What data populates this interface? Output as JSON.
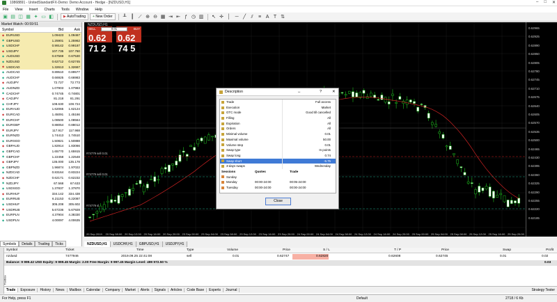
{
  "window": {
    "title": "10868891 - UnitedStandardFX-Demo: Demo Account - Hedge - [NZDUSD,H1]",
    "controls": [
      "–",
      "□",
      "✕"
    ]
  },
  "menu": [
    "File",
    "View",
    "Insert",
    "Charts",
    "Tools",
    "Window",
    "Help"
  ],
  "toolbar": {
    "autotrading": "AutoTrading",
    "new_order": "New Order"
  },
  "market_watch": {
    "title": "Market Watch: 00:59:51",
    "cols": {
      "symbol": "Symbol",
      "bid": "Bid",
      "ask": "Ask"
    },
    "rows": [
      {
        "sym": "EURUSD",
        "bid": "1.09423",
        "ask": "1.09467",
        "hl": true
      },
      {
        "sym": "GBPUSD",
        "bid": "1.25901",
        "ask": "1.25962",
        "hl": true
      },
      {
        "sym": "USDCHF",
        "bid": "0.99142",
        "ask": "0.99187",
        "hl": true
      },
      {
        "sym": "USDJPY",
        "bid": "107.735",
        "ask": "107.760",
        "hl": true
      },
      {
        "sym": "AUDUSD",
        "bid": "0.67569",
        "ask": "0.67530",
        "hl": true
      },
      {
        "sym": "NZDUSD",
        "bid": "0.62712",
        "ask": "0.62745",
        "hl": true
      },
      {
        "sym": "USDCAD",
        "bid": "1.32613",
        "ask": "1.32667",
        "hl": true
      },
      {
        "sym": "AUDCAD",
        "bid": "0.89510",
        "ask": "0.89577",
        "hl": false
      },
      {
        "sym": "AUDCHF",
        "bid": "0.66925",
        "ask": "0.66983",
        "hl": false
      },
      {
        "sym": "AUDJPY",
        "bid": "72.727",
        "ask": "72.773",
        "hl": false
      },
      {
        "sym": "AUDNZD",
        "bid": "1.07903",
        "ask": "1.07983",
        "hl": false
      },
      {
        "sym": "CADCHF",
        "bid": "0.74745",
        "ask": "0.74801",
        "hl": false
      },
      {
        "sym": "CADJPY",
        "bid": "81.218",
        "ask": "81.291",
        "hl": false
      },
      {
        "sym": "CHFJPY",
        "bid": "108.630",
        "ask": "108.724",
        "hl": false
      },
      {
        "sym": "EURAUD",
        "bid": "1.62065",
        "ask": "1.62124",
        "hl": false
      },
      {
        "sym": "EURCAD",
        "bid": "1.45091",
        "ask": "1.45166",
        "hl": false
      },
      {
        "sym": "EURCHF",
        "bid": "1.08500",
        "ask": "1.08564",
        "hl": false
      },
      {
        "sym": "EURGBP",
        "bid": "0.88054",
        "ask": "0.88012",
        "hl": false
      },
      {
        "sym": "EURJPY",
        "bid": "117.917",
        "ask": "117.968",
        "hl": false
      },
      {
        "sym": "EURNZD",
        "bid": "1.74413",
        "ask": "1.74510",
        "hl": false
      },
      {
        "sym": "EURSGD",
        "bid": "1.50821",
        "ask": "1.50888",
        "hl": false
      },
      {
        "sym": "GBPAUD",
        "bid": "1.82914",
        "ask": "1.83066",
        "hl": false
      },
      {
        "sym": "GBPCAD",
        "bid": "1.65770",
        "ask": "1.65915",
        "hl": false
      },
      {
        "sym": "GBPCHF",
        "bid": "1.22458",
        "ask": "1.22548",
        "hl": false
      },
      {
        "sym": "GBPJPY",
        "bid": "135.000",
        "ask": "135.178",
        "hl": false
      },
      {
        "sym": "GBPNZD",
        "bid": "1.96874",
        "ask": "1.97022",
        "hl": false
      },
      {
        "sym": "NZDCAD",
        "bid": "0.83164",
        "ask": "0.83224",
        "hl": false
      },
      {
        "sym": "NZDCHF",
        "bid": "0.62171",
        "ask": "0.62232",
        "hl": false
      },
      {
        "sym": "NZDJPY",
        "bid": "67.568",
        "ask": "67.633",
        "hl": false
      },
      {
        "sym": "USDSGD",
        "bid": "1.37837",
        "ask": "1.37870",
        "hl": false
      },
      {
        "sym": "EURHUF",
        "bid": "334.142",
        "ask": "334.438",
        "hl": false
      },
      {
        "sym": "EURRUB",
        "bid": "6.21153",
        "ask": "6.22087",
        "hl": false
      },
      {
        "sym": "USDHUF",
        "bid": "305.208",
        "ask": "305.602",
        "hl": false
      },
      {
        "sym": "USDRUB",
        "bid": "5.67236",
        "ask": "5.67928",
        "hl": false
      },
      {
        "sym": "EURPLN",
        "bid": "4.37904",
        "ask": "4.38330",
        "hl": false
      },
      {
        "sym": "USDPLN",
        "bid": "4.00097",
        "ask": "4.00635",
        "hl": false
      }
    ],
    "tabs": [
      "Symbols",
      "Details",
      "Trading",
      "Ticks"
    ]
  },
  "one_click": {
    "sell": "SELL",
    "buy": "BUY",
    "lot": "0.01",
    "sell_price": "0.62 71 2",
    "buy_price": "0.62 74 5"
  },
  "chart": {
    "title": "NZDUSD,H1",
    "price_labels": [
      "0.62965",
      "0.62925",
      "0.62890",
      "0.62850",
      "0.62805",
      "0.62780",
      "0.62745",
      "0.62710",
      "0.62675",
      "0.62640",
      "0.62605",
      "0.62570",
      "0.62535",
      "0.62500",
      "0.62465",
      "0.62430",
      "0.62395",
      "0.62360",
      "0.62325",
      "0.62290",
      "0.62255",
      "0.62220",
      "0.62185"
    ],
    "time_labels": [
      "20 Sep 2019",
      "20 Sep 08:00",
      "20 Sep 12:00",
      "20 Sep 16:00",
      "20 Sep 20:00",
      "23 Sep 00:00",
      "23 Sep 04:00",
      "23 Sep 08:00",
      "23 Sep 12:00",
      "23 Sep 16:00",
      "23 Sep 20:00",
      "24 Sep 00:00",
      "24 Sep 04:00",
      "24 Sep 08:00",
      "24 Sep 12:00",
      "24 Sep 16:00",
      "24 Sep 20:00",
      "25 Sep 00:00",
      "25 Sep 04:00",
      "25 Sep 08:00",
      "25 Sep 12:00",
      "25 Sep 16:00",
      "25 Sep 20:00"
    ],
    "level_labels": [
      "#74779 sell 0.01",
      "#74779 sell 0.01",
      "#74779 sl"
    ],
    "tabs": [
      "NZDUSD,H1",
      "USDCHF,H1",
      "GBPUSD,H1",
      "USDJPY,H1"
    ]
  },
  "dialog": {
    "title": "Description",
    "controls": [
      "?",
      "✕"
    ],
    "props": [
      {
        "k": "Trade",
        "v": "Full access"
      },
      {
        "k": "Execution",
        "v": "Market"
      },
      {
        "k": "GTC mode",
        "v": "Good till cancelled"
      },
      {
        "k": "Filling",
        "v": "All"
      },
      {
        "k": "Expiration",
        "v": "All"
      },
      {
        "k": "Orders",
        "v": "All"
      },
      {
        "k": "Minimal volume",
        "v": "0.01"
      },
      {
        "k": "Maximal volume",
        "v": "50.00"
      },
      {
        "k": "Volume step",
        "v": "0.01"
      },
      {
        "k": "Swap type",
        "v": "In points"
      },
      {
        "k": "Swap long",
        "v": "0.74"
      },
      {
        "k": "Swap short",
        "v": "-5.75"
      },
      {
        "k": "3-days swaps",
        "v": "Wednesday"
      }
    ],
    "sessions_head": {
      "a": "Sessions",
      "b": "Quotes",
      "c": "Trade"
    },
    "sessions": [
      {
        "d": "Sunday",
        "q": "",
        "t": ""
      },
      {
        "d": "Monday",
        "q": "00:00-24:00",
        "t": "00:05-24:00"
      },
      {
        "d": "Tuesday",
        "q": "00:00-24:00",
        "t": "00:00-24:00"
      }
    ],
    "close": "Close"
  },
  "terminal": {
    "cols": {
      "symbol": "Symbol",
      "ticket": "Ticket",
      "time": "Time",
      "type": "Type",
      "volume": "Volume",
      "price": "Price",
      "sl": "S / L",
      "tp": "T / P",
      "price2": "Price",
      "swap": "Swap",
      "profit": "Profit"
    },
    "row": {
      "symbol": "nzdusd",
      "ticket": "7477946",
      "time": "2019.09.25 22:41:08",
      "type": "sell",
      "volume": "0.01",
      "price": "0.62747",
      "sl": "0.62820",
      "tp": "0.62608",
      "price2": "0.62745",
      "swap": "0.01",
      "profit": "0.02"
    },
    "balance": "Balance: 9 999.42 USD  Equity: 9 999.45  Margin: 2.00  Free Margin: 9 997.45  Margin Level: 499 972.50 %",
    "balance_profit": "0.03",
    "tabs": [
      "Trade",
      "Exposure",
      "History",
      "News",
      "Mailbox",
      "Calendar",
      "Company",
      "Market",
      "Alerts",
      "Signals",
      "Articles",
      "Code Base",
      "Experts",
      "Journal"
    ],
    "side_label": "Toolbox",
    "tester": "Strategy Tester"
  },
  "status": {
    "help": "For Help, press F1",
    "profile": "Default",
    "traffic": "2718 / 6 Kb"
  }
}
